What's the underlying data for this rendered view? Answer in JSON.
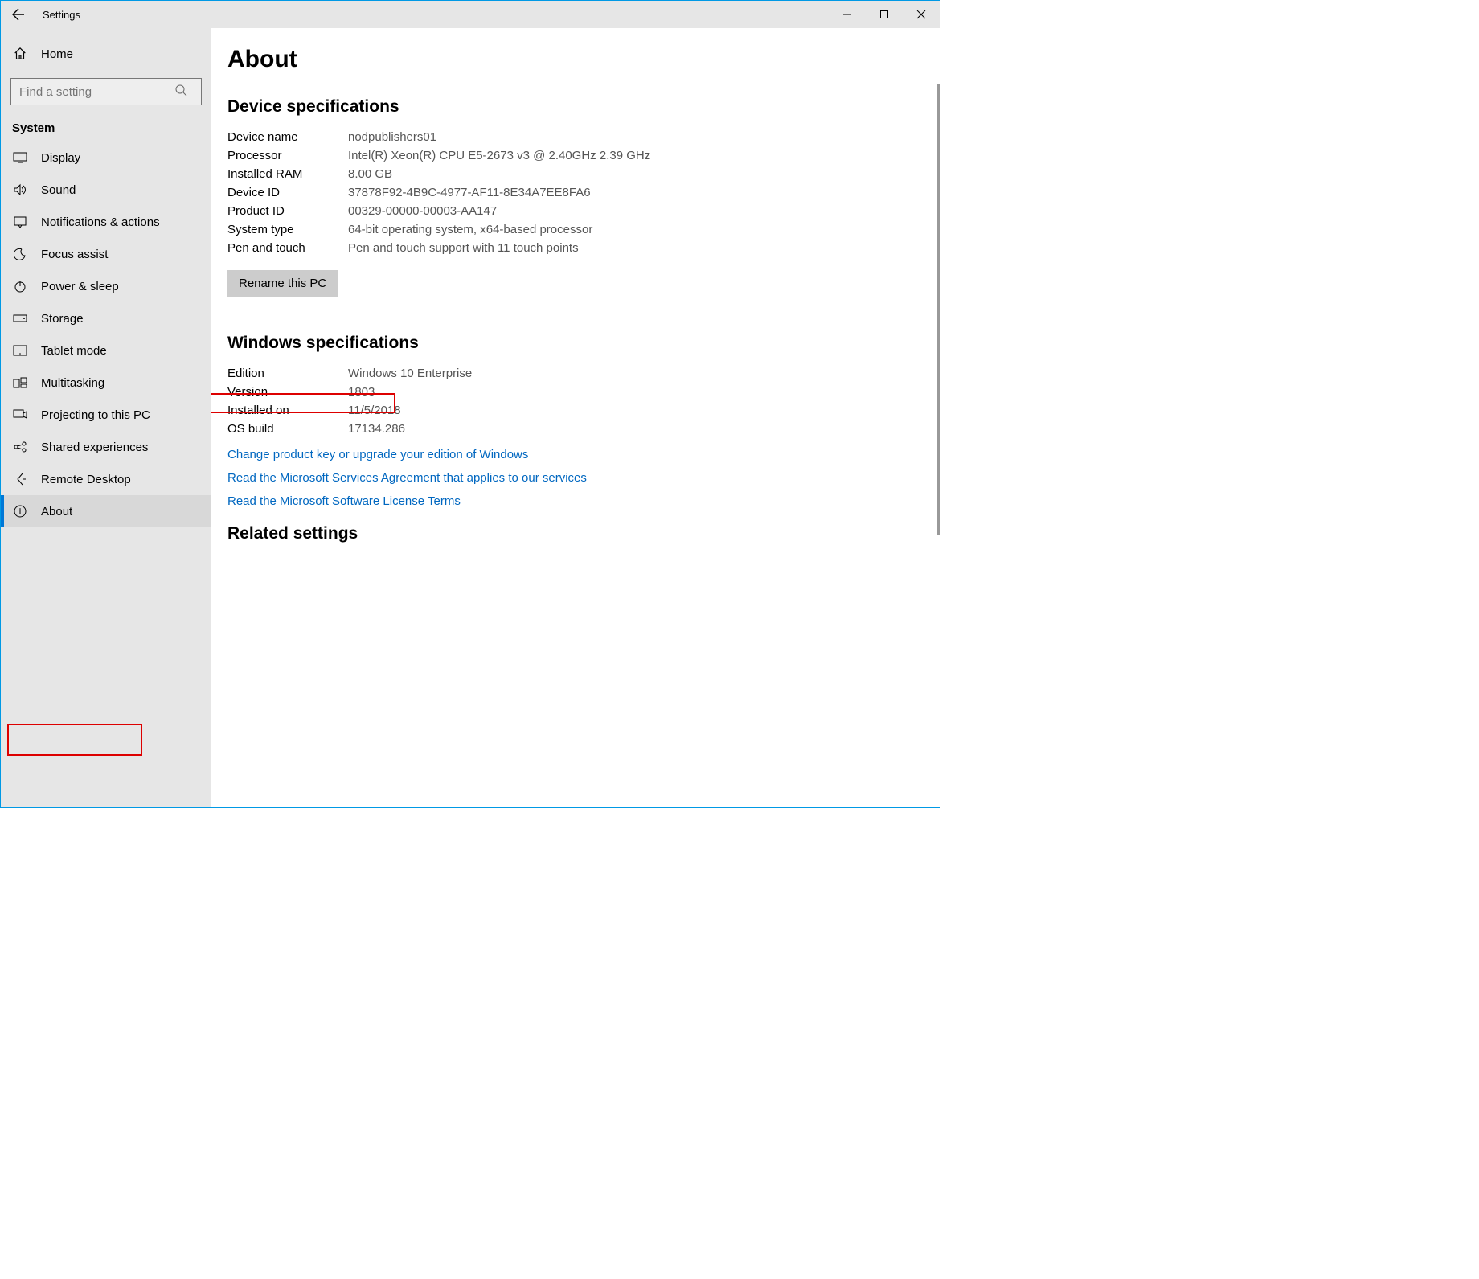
{
  "titlebar": {
    "title": "Settings"
  },
  "sidebar": {
    "home": "Home",
    "search_placeholder": "Find a setting",
    "category": "System",
    "items": [
      {
        "label": "Display"
      },
      {
        "label": "Sound"
      },
      {
        "label": "Notifications & actions"
      },
      {
        "label": "Focus assist"
      },
      {
        "label": "Power & sleep"
      },
      {
        "label": "Storage"
      },
      {
        "label": "Tablet mode"
      },
      {
        "label": "Multitasking"
      },
      {
        "label": "Projecting to this PC"
      },
      {
        "label": "Shared experiences"
      },
      {
        "label": "Remote Desktop"
      },
      {
        "label": "About"
      }
    ]
  },
  "content": {
    "title": "About",
    "device_header": "Device specifications",
    "device": {
      "name_label": "Device name",
      "name_value": "nodpublishers01",
      "proc_label": "Processor",
      "proc_value": "Intel(R) Xeon(R) CPU E5-2673 v3 @ 2.40GHz 2.39 GHz",
      "ram_label": "Installed RAM",
      "ram_value": "8.00 GB",
      "devid_label": "Device ID",
      "devid_value": "37878F92-4B9C-4977-AF11-8E34A7EE8FA6",
      "prodid_label": "Product ID",
      "prodid_value": "00329-00000-00003-AA147",
      "type_label": "System type",
      "type_value": "64-bit operating system, x64-based processor",
      "pen_label": "Pen and touch",
      "pen_value": "Pen and touch support with 11 touch points"
    },
    "rename_button": "Rename this PC",
    "windows_header": "Windows specifications",
    "windows": {
      "edition_label": "Edition",
      "edition_value": "Windows 10 Enterprise",
      "version_label": "Version",
      "version_value": "1803",
      "installed_label": "Installed on",
      "installed_value": "11/5/2018",
      "build_label": "OS build",
      "build_value": "17134.286"
    },
    "link_productkey": "Change product key or upgrade your edition of Windows",
    "link_services": "Read the Microsoft Services Agreement that applies to our services",
    "link_license": "Read the Microsoft Software License Terms",
    "related_header": "Related settings"
  }
}
